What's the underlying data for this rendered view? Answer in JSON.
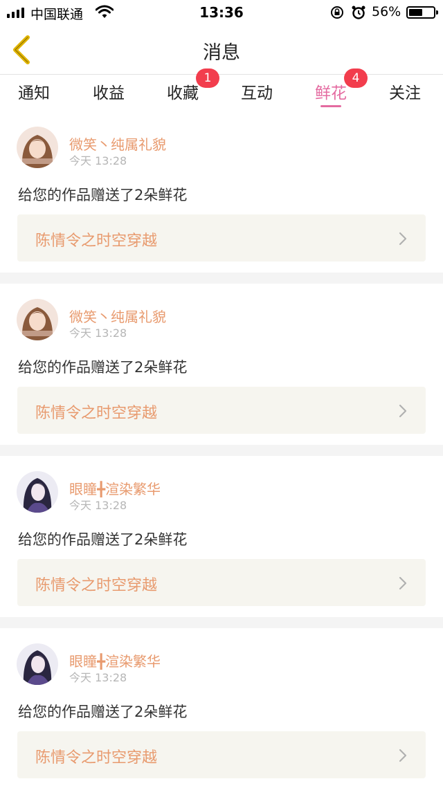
{
  "status_bar": {
    "carrier": "中国联通",
    "time": "13:36",
    "battery_percent": "56%",
    "battery_level": 0.56
  },
  "nav": {
    "title": "消息",
    "back_icon": "chevron-left-icon",
    "accent_color": "#e0b400"
  },
  "tabs": [
    {
      "label": "通知",
      "badge": ""
    },
    {
      "label": "收益",
      "badge": ""
    },
    {
      "label": "收藏",
      "badge": "1"
    },
    {
      "label": "互动",
      "badge": ""
    },
    {
      "label": "鲜花",
      "badge": "4",
      "active": true
    },
    {
      "label": "关注",
      "badge": ""
    }
  ],
  "colors": {
    "active_tab": "#e46aa0",
    "badge": "#f23d4d",
    "username": "#e89a6e",
    "link_bg": "#f6f5ef"
  },
  "messages": [
    {
      "user": "微笑丶纯属礼貌",
      "time": "今天 13:28",
      "text": "给您的作品赠送了2朵鲜花",
      "work": "陈情令之时空穿越",
      "avatar": "avatar-girl-1"
    },
    {
      "user": "微笑丶纯属礼貌",
      "time": "今天 13:28",
      "text": "给您的作品赠送了2朵鲜花",
      "work": "陈情令之时空穿越",
      "avatar": "avatar-girl-1"
    },
    {
      "user": "眼瞳╋渲染繁华",
      "time": "今天 13:28",
      "text": "给您的作品赠送了2朵鲜花",
      "work": "陈情令之时空穿越",
      "avatar": "avatar-girl-2"
    },
    {
      "user": "眼瞳╋渲染繁华",
      "time": "今天 13:28",
      "text": "给您的作品赠送了2朵鲜花",
      "work": "陈情令之时空穿越",
      "avatar": "avatar-girl-2"
    }
  ]
}
